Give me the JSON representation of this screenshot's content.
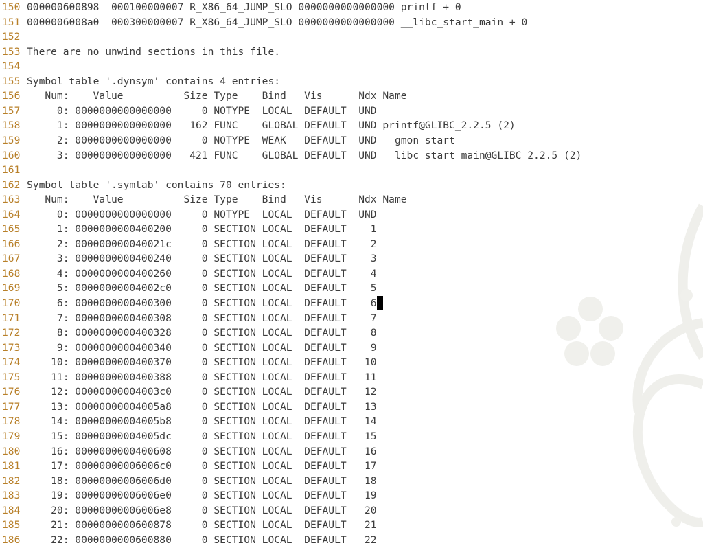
{
  "editor": {
    "cursor": {
      "line": 170
    },
    "lines": [
      {
        "n": "150",
        "text": "000000600898  000100000007 R_X86_64_JUMP_SLO 0000000000000000 printf + 0"
      },
      {
        "n": "151",
        "text": "0000006008a0  000300000007 R_X86_64_JUMP_SLO 0000000000000000 __libc_start_main + 0"
      },
      {
        "n": "152",
        "text": ""
      },
      {
        "n": "153",
        "text": "There are no unwind sections in this file."
      },
      {
        "n": "154",
        "text": ""
      },
      {
        "n": "155",
        "text": "Symbol table '.dynsym' contains 4 entries:"
      },
      {
        "n": "156",
        "text": "   Num:    Value          Size Type    Bind   Vis      Ndx Name"
      },
      {
        "n": "157",
        "text": "     0: 0000000000000000     0 NOTYPE  LOCAL  DEFAULT  UND"
      },
      {
        "n": "158",
        "text": "     1: 0000000000000000   162 FUNC    GLOBAL DEFAULT  UND printf@GLIBC_2.2.5 (2)"
      },
      {
        "n": "159",
        "text": "     2: 0000000000000000     0 NOTYPE  WEAK   DEFAULT  UND __gmon_start__"
      },
      {
        "n": "160",
        "text": "     3: 0000000000000000   421 FUNC    GLOBAL DEFAULT  UND __libc_start_main@GLIBC_2.2.5 (2)"
      },
      {
        "n": "161",
        "text": ""
      },
      {
        "n": "162",
        "text": "Symbol table '.symtab' contains 70 entries:"
      },
      {
        "n": "163",
        "text": "   Num:    Value          Size Type    Bind   Vis      Ndx Name"
      },
      {
        "n": "164",
        "text": "     0: 0000000000000000     0 NOTYPE  LOCAL  DEFAULT  UND"
      },
      {
        "n": "165",
        "text": "     1: 0000000000400200     0 SECTION LOCAL  DEFAULT    1"
      },
      {
        "n": "166",
        "text": "     2: 000000000040021c     0 SECTION LOCAL  DEFAULT    2"
      },
      {
        "n": "167",
        "text": "     3: 0000000000400240     0 SECTION LOCAL  DEFAULT    3"
      },
      {
        "n": "168",
        "text": "     4: 0000000000400260     0 SECTION LOCAL  DEFAULT    4"
      },
      {
        "n": "169",
        "text": "     5: 00000000004002c0     0 SECTION LOCAL  DEFAULT    5"
      },
      {
        "n": "170",
        "text": "     6: 0000000000400300     0 SECTION LOCAL  DEFAULT    6"
      },
      {
        "n": "171",
        "text": "     7: 0000000000400308     0 SECTION LOCAL  DEFAULT    7"
      },
      {
        "n": "172",
        "text": "     8: 0000000000400328     0 SECTION LOCAL  DEFAULT    8"
      },
      {
        "n": "173",
        "text": "     9: 0000000000400340     0 SECTION LOCAL  DEFAULT    9"
      },
      {
        "n": "174",
        "text": "    10: 0000000000400370     0 SECTION LOCAL  DEFAULT   10"
      },
      {
        "n": "175",
        "text": "    11: 0000000000400388     0 SECTION LOCAL  DEFAULT   11"
      },
      {
        "n": "176",
        "text": "    12: 00000000004003c0     0 SECTION LOCAL  DEFAULT   12"
      },
      {
        "n": "177",
        "text": "    13: 00000000004005a8     0 SECTION LOCAL  DEFAULT   13"
      },
      {
        "n": "178",
        "text": "    14: 00000000004005b8     0 SECTION LOCAL  DEFAULT   14"
      },
      {
        "n": "179",
        "text": "    15: 00000000004005dc     0 SECTION LOCAL  DEFAULT   15"
      },
      {
        "n": "180",
        "text": "    16: 0000000000400608     0 SECTION LOCAL  DEFAULT   16"
      },
      {
        "n": "181",
        "text": "    17: 00000000006006c0     0 SECTION LOCAL  DEFAULT   17"
      },
      {
        "n": "182",
        "text": "    18: 00000000006006d0     0 SECTION LOCAL  DEFAULT   18"
      },
      {
        "n": "183",
        "text": "    19: 00000000006006e0     0 SECTION LOCAL  DEFAULT   19"
      },
      {
        "n": "184",
        "text": "    20: 00000000006006e8     0 SECTION LOCAL  DEFAULT   20"
      },
      {
        "n": "185",
        "text": "    21: 0000000000600878     0 SECTION LOCAL  DEFAULT   21"
      },
      {
        "n": "186",
        "text": "    22: 0000000000600880     0 SECTION LOCAL  DEFAULT   22"
      }
    ]
  },
  "colors": {
    "line_number": "#b8802a",
    "text": "#3c3c3c",
    "background": "#ffffff",
    "decoration": "#eeeeea",
    "cursor": "#000000"
  }
}
